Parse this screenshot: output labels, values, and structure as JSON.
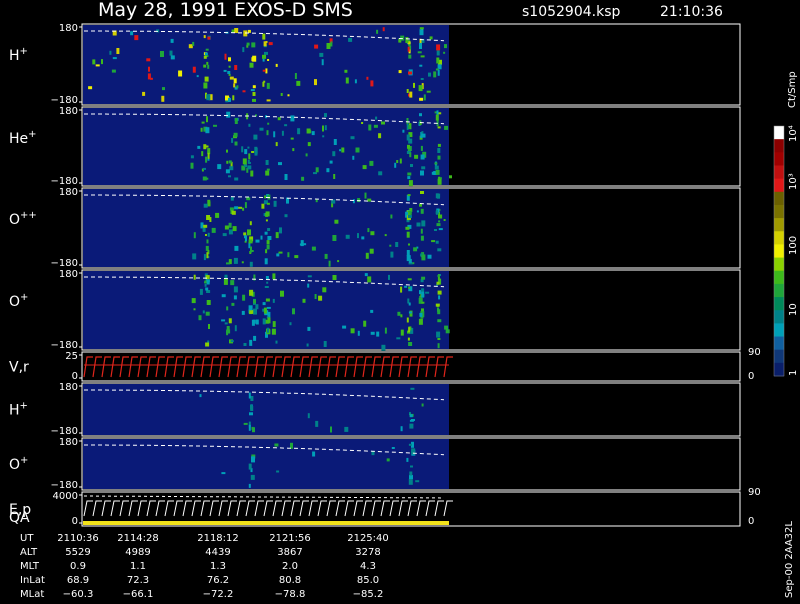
{
  "header": {
    "title": "May 28, 1991    EXOS-D SMS",
    "file": "s1052904.ksp",
    "time": "21:10:36"
  },
  "colors": {
    "background": "#000000",
    "panel_base": "#0a1a78",
    "dashed_line": "#ffffff",
    "velocity_trace": "#e0251b",
    "qa_bar": "#f2e21a"
  },
  "colorbar": {
    "unit": "Ct/Smp",
    "labels": [
      "10⁴",
      "10³",
      "100",
      "10",
      "1"
    ],
    "colors": [
      "#ffffff",
      "#8b0000",
      "#a00000",
      "#c01010",
      "#e01818",
      "#6b6000",
      "#7a7200",
      "#a09a00",
      "#d4d000",
      "#f0f000",
      "#8ad100",
      "#3dba1b",
      "#1fa63a",
      "#008a5a",
      "#00828a",
      "#00a0b8",
      "#1060a0",
      "#103878",
      "#0a1f6a"
    ]
  },
  "chart_data": {
    "type": "heatmap",
    "time_range": [
      "21:10:36",
      "21:25:40"
    ],
    "panels": [
      {
        "label": "H",
        "sup": "+",
        "ylim": [
          -180,
          180
        ],
        "tick_top": "180",
        "tick_bottom": "−180",
        "kind": "spectrogram"
      },
      {
        "label": "He",
        "sup": "+",
        "ylim": [
          -180,
          180
        ],
        "tick_top": "180",
        "tick_bottom": "−180",
        "kind": "spectrogram"
      },
      {
        "label": "O",
        "sup": "++",
        "ylim": [
          -180,
          180
        ],
        "tick_top": "180",
        "tick_bottom": "−180",
        "kind": "spectrogram"
      },
      {
        "label": "O",
        "sup": "+",
        "ylim": [
          -180,
          180
        ],
        "tick_top": "180",
        "tick_bottom": "−180",
        "kind": "spectrogram"
      },
      {
        "label": "V,r",
        "sup": "",
        "ylim": [
          0,
          25
        ],
        "tick_top": "25",
        "tick_bottom": "0",
        "right_top": "90",
        "right_bottom": "0",
        "kind": "velocity"
      },
      {
        "label": "H",
        "sup": "+",
        "ylim": [
          -180,
          180
        ],
        "tick_top": "180",
        "tick_bottom": "−180",
        "kind": "spectrogram"
      },
      {
        "label": "O",
        "sup": "+",
        "ylim": [
          -180,
          180
        ],
        "tick_top": "180",
        "tick_bottom": "−180",
        "kind": "spectrogram"
      },
      {
        "label": "E,p",
        "label2": "QA",
        "sup": "",
        "ylim": [
          0,
          4000
        ],
        "tick_top": "4000",
        "tick_bottom": "0",
        "right_top": "90",
        "right_bottom": "0",
        "kind": "ep"
      }
    ],
    "orbit_table": {
      "rows": [
        {
          "name": "UT",
          "values": [
            "2110:36",
            "2114:28",
            "2118:12",
            "2121:56",
            "2125:40"
          ]
        },
        {
          "name": "ALT",
          "values": [
            "5529",
            "4989",
            "4439",
            "3867",
            "3278"
          ]
        },
        {
          "name": "MLT",
          "values": [
            "0.9",
            "1.1",
            "1.3",
            "2.0",
            "4.3"
          ]
        },
        {
          "name": "InLat",
          "values": [
            "68.9",
            "72.3",
            "76.2",
            "80.8",
            "85.0"
          ]
        },
        {
          "name": "MLat",
          "values": [
            "−60.3",
            "−66.1",
            "−72.2",
            "−78.8",
            "−85.2"
          ]
        }
      ]
    },
    "footer_note": "Sep-00  2AA32L"
  }
}
